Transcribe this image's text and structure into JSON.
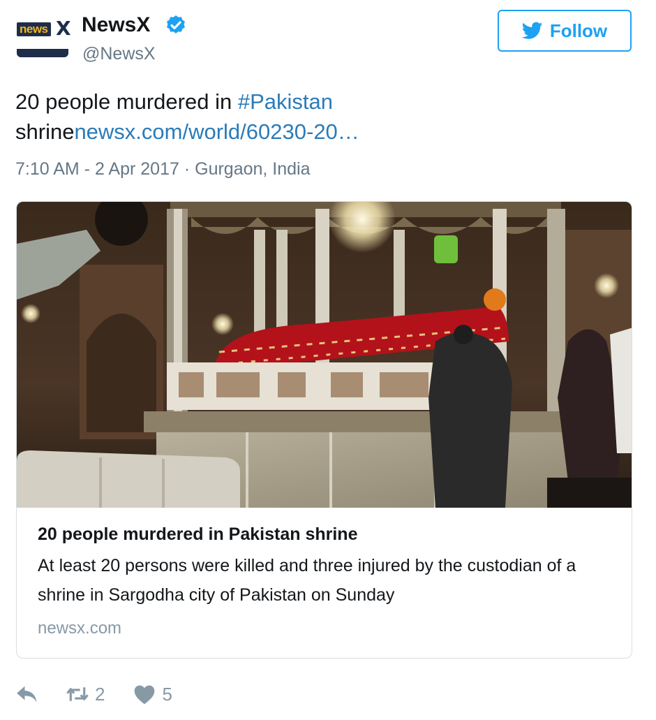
{
  "account": {
    "logo_text": "news",
    "logo_mark": "X",
    "name": "NewsX",
    "handle": "@NewsX",
    "verified": true
  },
  "follow": {
    "label": "Follow",
    "icon": "twitter-bird-icon"
  },
  "tweet": {
    "text_prefix": "20 people murdered in ",
    "hashtag": "#Pakistan",
    "text_middle": " shrine",
    "link": "newsx.com/world/60230-20…",
    "timestamp": "7:10 AM - 2 Apr 2017",
    "separator": "·",
    "location": "Gurgaon, India"
  },
  "card": {
    "title": "20 people murdered in Pakistan shrine",
    "description": "At least 20 persons were killed and three injured by the custodian of a shrine in Sargodha city of Pakistan on Sunday",
    "domain": "newsx.com"
  },
  "actions": {
    "reply": {
      "icon": "reply-icon"
    },
    "retweet": {
      "icon": "retweet-icon",
      "count": "2"
    },
    "like": {
      "icon": "heart-icon",
      "count": "5"
    }
  },
  "colors": {
    "link": "#2b7bb9",
    "accent": "#1da1f2",
    "muted": "#657786"
  }
}
